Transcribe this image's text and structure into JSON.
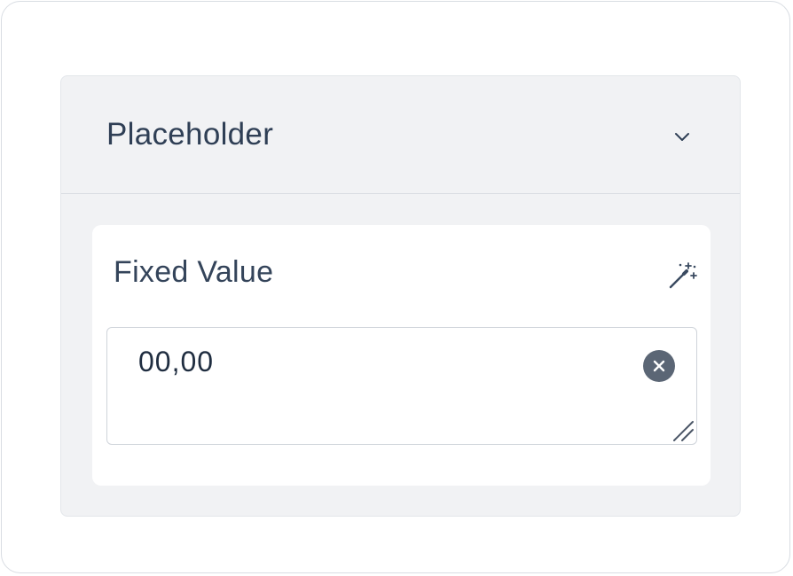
{
  "panel": {
    "title": "Placeholder",
    "collapse_icon": "chevron-down-icon"
  },
  "field": {
    "label": "Fixed Value",
    "action_icon": "magic-wand-icon",
    "value": "00,00",
    "clear_icon": "clear-circle-icon",
    "resize_icon": "resize-handle-icon"
  },
  "colors": {
    "panel_background": "#f1f2f4",
    "card_background": "#ffffff",
    "text_primary": "#2f3f55",
    "clear_button": "#5b6675"
  }
}
